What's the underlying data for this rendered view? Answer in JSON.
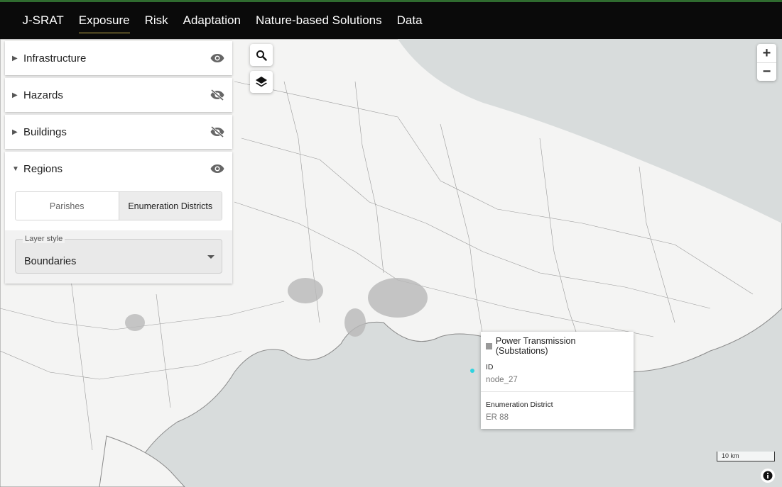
{
  "nav": {
    "brand": "J-SRAT",
    "items": [
      "Exposure",
      "Risk",
      "Adaptation",
      "Nature-based Solutions",
      "Data"
    ],
    "active": "Exposure",
    "accent_color": "#c9b24d"
  },
  "panel": {
    "sections": [
      {
        "title": "Infrastructure",
        "expanded": false,
        "visible": true
      },
      {
        "title": "Hazards",
        "expanded": false,
        "visible": false
      },
      {
        "title": "Buildings",
        "expanded": false,
        "visible": false
      },
      {
        "title": "Regions",
        "expanded": true,
        "visible": true
      }
    ],
    "regions": {
      "options": [
        "Parishes",
        "Enumeration Districts"
      ],
      "selected": "Enumeration Districts",
      "layer_style_label": "Layer style",
      "layer_style_value": "Boundaries"
    }
  },
  "map": {
    "icons": [
      "search-icon",
      "layers-icon",
      "zoom-in-icon",
      "zoom-out-icon",
      "info-icon"
    ],
    "zoom_in": "+",
    "zoom_out": "−",
    "scale_label": "10 km",
    "marker_color": "#2fd3e0"
  },
  "tooltip": {
    "title": "Power Transmission (Substations)",
    "fields": [
      {
        "label": "ID",
        "value": "node_27"
      },
      {
        "label": "Enumeration District",
        "value": "ER 88"
      }
    ]
  }
}
